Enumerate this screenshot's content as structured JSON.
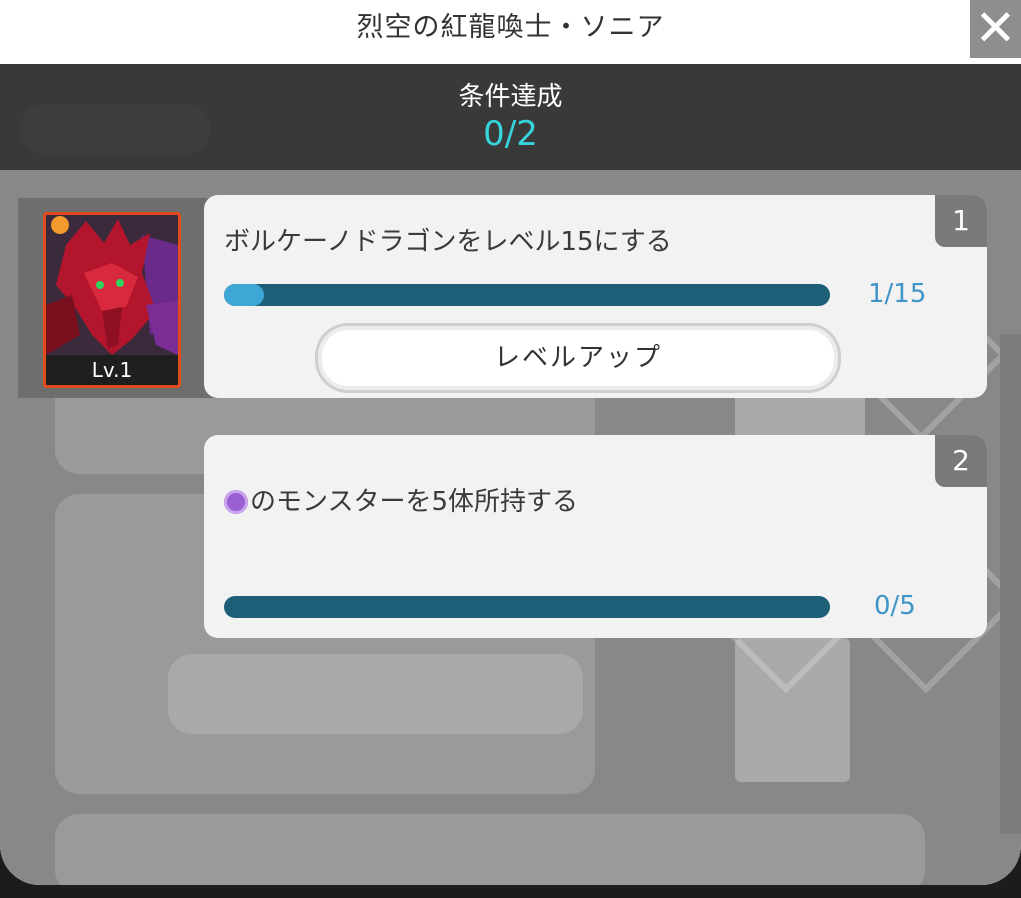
{
  "window": {
    "title": "烈空の紅龍喚士・ソニア"
  },
  "header": {
    "title": "条件達成",
    "progress": "0/2"
  },
  "monster": {
    "level_label": "Lv.1",
    "attribute_color": "#e24b1c"
  },
  "conditions": [
    {
      "number": "1",
      "text": "ボルケーノドラゴンをレベル15にする",
      "current": 1,
      "target": 15,
      "count_label": "1/15",
      "button_label": "レベルアップ"
    },
    {
      "number": "2",
      "icon": "purple-attribute-orb-icon",
      "text": "のモンスターを5体所持する",
      "current": 0,
      "target": 5,
      "count_label": "0/5"
    }
  ],
  "colors": {
    "progress_track": "#1e5f78",
    "progress_fill": "#3fa7d6",
    "progress_text": "#37d4dc"
  }
}
